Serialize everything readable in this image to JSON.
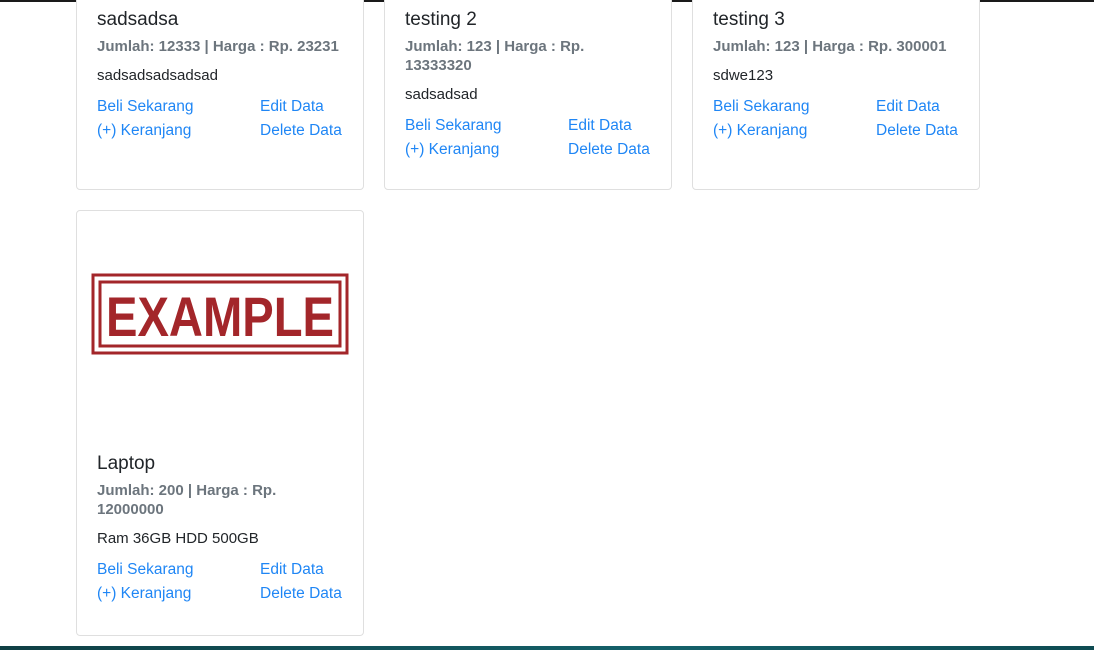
{
  "products": [
    {
      "title": "sadsadsa",
      "subtitle": "Jumlah: 12333 | Harga : Rp. 23231",
      "description": "sadsadsadsadsad",
      "actions": {
        "buy": "Beli Sekarang",
        "edit": "Edit Data",
        "cart": "(+) Keranjang",
        "delete": "Delete Data"
      }
    },
    {
      "title": "testing 2",
      "subtitle": "Jumlah: 123 | Harga : Rp. 13333320",
      "description": "sadsadsad",
      "actions": {
        "buy": "Beli Sekarang",
        "edit": "Edit Data",
        "cart": "(+) Keranjang",
        "delete": "Delete Data"
      }
    },
    {
      "title": "testing 3",
      "subtitle": "Jumlah: 123 | Harga : Rp. 300001",
      "description": "sdwe123",
      "actions": {
        "buy": "Beli Sekarang",
        "edit": "Edit Data",
        "cart": "(+) Keranjang",
        "delete": "Delete Data"
      }
    },
    {
      "title": "Laptop",
      "subtitle": "Jumlah: 200 | Harga : Rp. 12000000",
      "description": "Ram 36GB HDD 500GB",
      "image_text": "EXAMPLE",
      "actions": {
        "buy": "Beli Sekarang",
        "edit": "Edit Data",
        "cart": "(+) Keranjang",
        "delete": "Delete Data"
      }
    }
  ],
  "colors": {
    "link": "#1f86f5",
    "stamp": "#a3262a",
    "muted": "#6c757d"
  }
}
